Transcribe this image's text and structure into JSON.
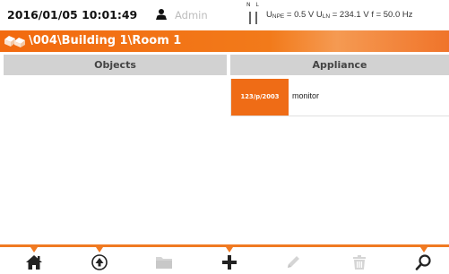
{
  "status": {
    "datetime": "2016/01/05 10:01:49",
    "user": "Admin",
    "nl_label": "N L",
    "upe_label": "U",
    "upe_sub": "NPE",
    "upe_value": " = 0.5 V ",
    "uln_label": "U",
    "uln_sub": "LN",
    "uln_value": " = 234.1 V ",
    "freq": "f = 50.0 Hz"
  },
  "breadcrumb": {
    "path": "\\004\\Building 1\\Room 1"
  },
  "columns": {
    "objects": "Objects",
    "appliance": "Appliance"
  },
  "appliances": [
    {
      "id": "123/p/2003",
      "name": "monitor"
    }
  ],
  "toolbar": {
    "buttons": [
      {
        "name": "home-icon",
        "enabled": true
      },
      {
        "name": "select-icon",
        "enabled": true
      },
      {
        "name": "folder-icon",
        "enabled": false
      },
      {
        "name": "add-icon",
        "enabled": true
      },
      {
        "name": "edit-icon",
        "enabled": false
      },
      {
        "name": "delete-icon",
        "enabled": false
      },
      {
        "name": "search-icon",
        "enabled": true
      }
    ]
  },
  "colors": {
    "accent": "#f26a0f",
    "header_bg": "#d2d2d2",
    "disabled": "#d5d5d5"
  }
}
